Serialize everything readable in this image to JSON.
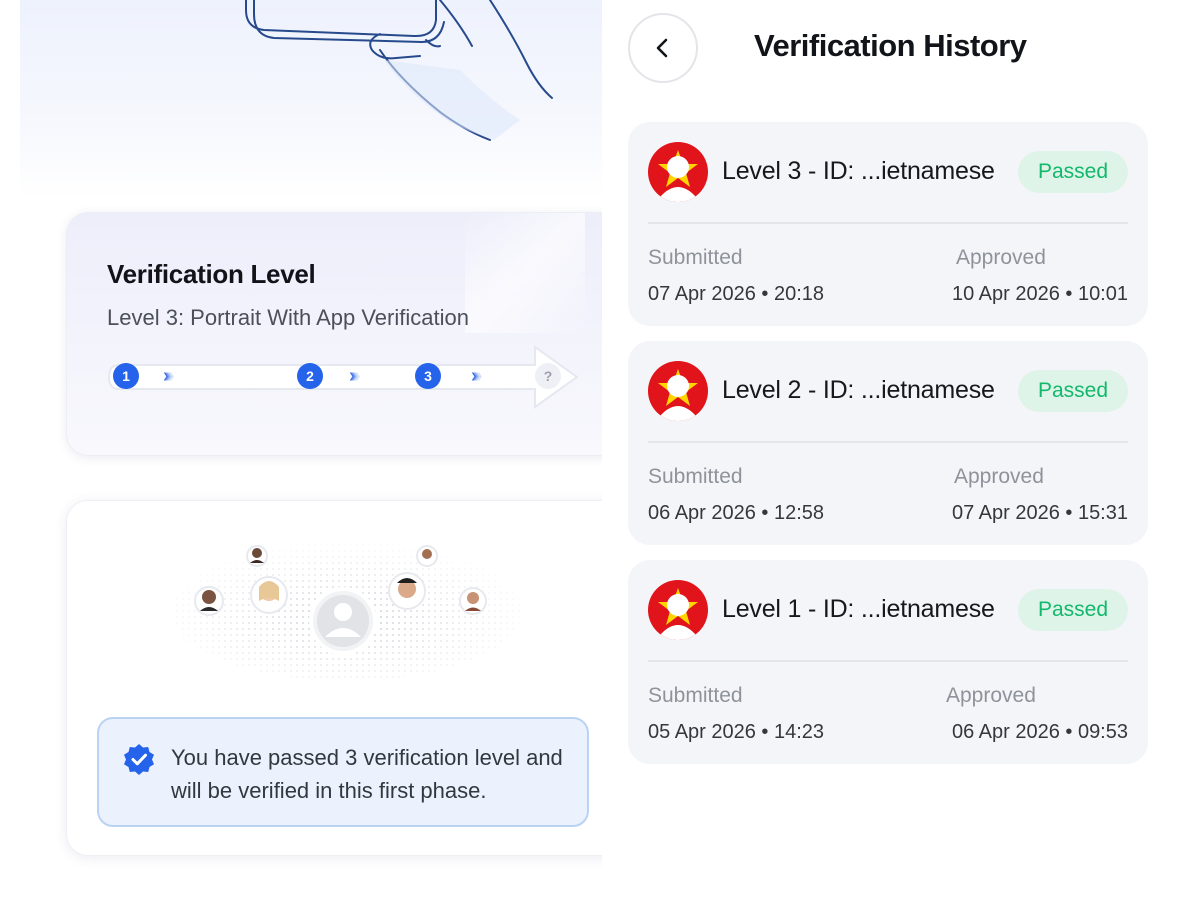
{
  "verification_level": {
    "title": "Verification Level",
    "subtitle": "Level 3: Portrait With App Verification",
    "steps": [
      "1",
      "2",
      "3",
      "?"
    ]
  },
  "notice": {
    "text": "You have passed 3 verification level and will be verified in this first phase."
  },
  "header": {
    "title": "Verification History",
    "back_icon": "chevron-left-icon"
  },
  "history": [
    {
      "title": "Level 3 - ID: ...ietnamese",
      "status": "Passed",
      "submitted_label": "Submitted",
      "submitted": "07 Apr 2026 • 20:18",
      "approved_label": "Approved",
      "approved": "10 Apr 2026 • 10:01"
    },
    {
      "title": "Level 2 - ID: ...ietnamese",
      "status": "Passed",
      "submitted_label": "Submitted",
      "submitted": "06 Apr 2026 • 12:58",
      "approved_label": "Approved",
      "approved": "07 Apr 2026 • 15:31"
    },
    {
      "title": "Level 1 - ID: ...ietnamese",
      "status": "Passed",
      "submitted_label": "Submitted",
      "submitted": "05 Apr 2026 • 14:23",
      "approved_label": "Approved",
      "approved": "06 Apr 2026 • 09:53"
    }
  ],
  "colors": {
    "accent_blue": "#2563eb",
    "passed_green": "#12b86b",
    "passed_bg": "#dff4e8",
    "flag_red": "#e1141b",
    "flag_star": "#ffd400"
  }
}
